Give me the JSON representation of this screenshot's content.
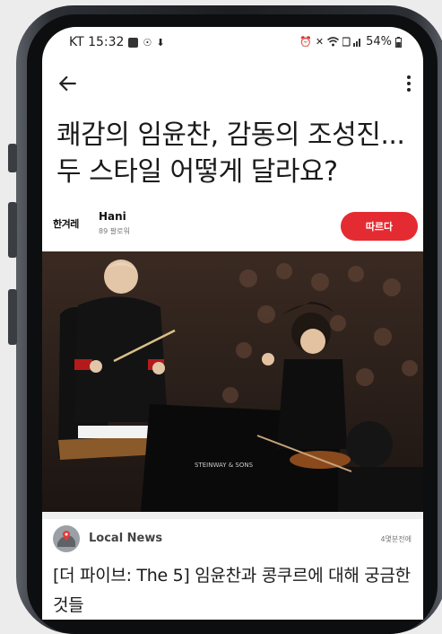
{
  "status_bar": {
    "carrier_time": "KT 15:32",
    "battery": "54%"
  },
  "article": {
    "title": "쾌감의 임윤찬, 감동의 조성진...두 스타일 어떻게 달라요?",
    "publisher": {
      "logo_text": "한겨레",
      "name": "Hani",
      "followers": "89 팔로워",
      "follow_label": "따르다"
    },
    "photo": {
      "piano_brand": "STEINWAY & SONS"
    }
  },
  "next_card": {
    "source_name": "Local News",
    "time_ago": "4몇분전에",
    "title": "[더 파이브: The 5] 임윤찬과 콩쿠르에 대해 궁금한 것들"
  },
  "colors": {
    "follow_button": "#e52b32",
    "title_text": "#1a1a1a"
  },
  "icons": [
    "back-arrow-icon",
    "more-vert-icon",
    "alarm-icon",
    "mute-icon",
    "wifi-icon",
    "signal-icon",
    "battery-icon"
  ]
}
